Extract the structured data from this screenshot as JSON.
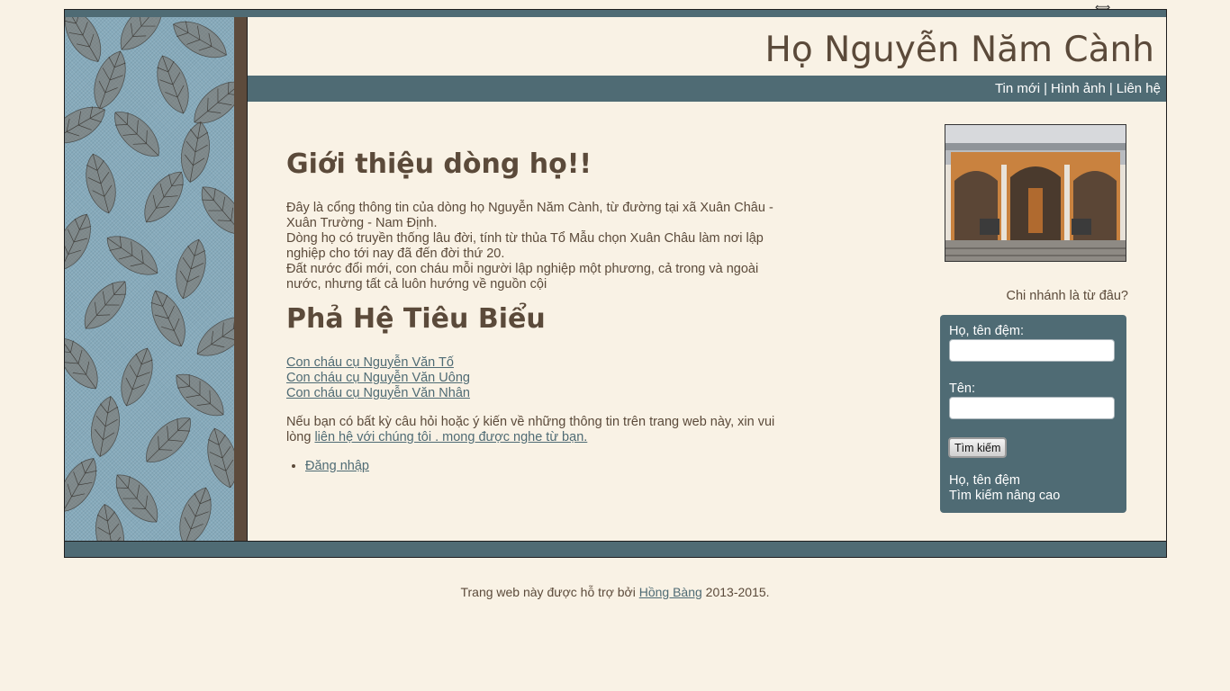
{
  "site": {
    "title": "Họ Nguyễn Năm Cành"
  },
  "nav": {
    "items": [
      "Tin mới",
      "Hình ảnh",
      "Liên hệ"
    ],
    "separator": "|"
  },
  "intro": {
    "heading": "Giới thiệu dòng họ!!",
    "line1": "Đây là cổng thông tin của dòng họ Nguyễn Năm Cành, từ đường tại xã Xuân Châu - Xuân Trường - Nam Định.",
    "line2": "Dòng họ có truyền thống lâu đời, tính từ thủa Tổ Mẫu chọn Xuân Châu làm nơi lập nghiệp cho tới nay đã đến đời thứ 20.",
    "line3": "Đất nước đổi mới, con cháu mỗi người lập nghiệp một phương, cả trong và ngoài nước, nhưng tất cả luôn hướng về nguồn cội"
  },
  "lineage": {
    "heading": "Phả Hệ Tiêu Biểu",
    "links": [
      "Con cháu cụ Nguyễn Văn Tố",
      "Con cháu cụ Nguyễn Văn Uông",
      "Con cháu cụ Nguyễn Văn Nhân"
    ]
  },
  "contact": {
    "text": "Nếu bạn có bất kỳ câu hỏi hoặc ý kiến về những thông tin trên trang web này, xin vui lòng ",
    "link": "liên hệ với chúng tôi . mong được nghe từ bạn."
  },
  "login": {
    "label": "Đăng nhập"
  },
  "sidebar": {
    "branch_question": "Chi nhánh là từ đâu?",
    "search": {
      "surname_label": "Họ, tên đệm:",
      "surname_value": "",
      "given_label": "Tên:",
      "given_value": "",
      "button": "Tìm kiếm",
      "link1": "Họ, tên đệm",
      "link2": "Tìm kiếm nâng cao"
    }
  },
  "footer": {
    "prefix": "Trang web này được hỗ trợ bởi ",
    "link": "Hồng Bàng",
    "suffix": " 2013-2015."
  },
  "colors": {
    "background": "#f9f2e5",
    "accent": "#4f6b74",
    "brown": "#5b4a3a",
    "side_bar": "#5d4b3c"
  },
  "icons": {
    "resize": "resize-icon"
  }
}
